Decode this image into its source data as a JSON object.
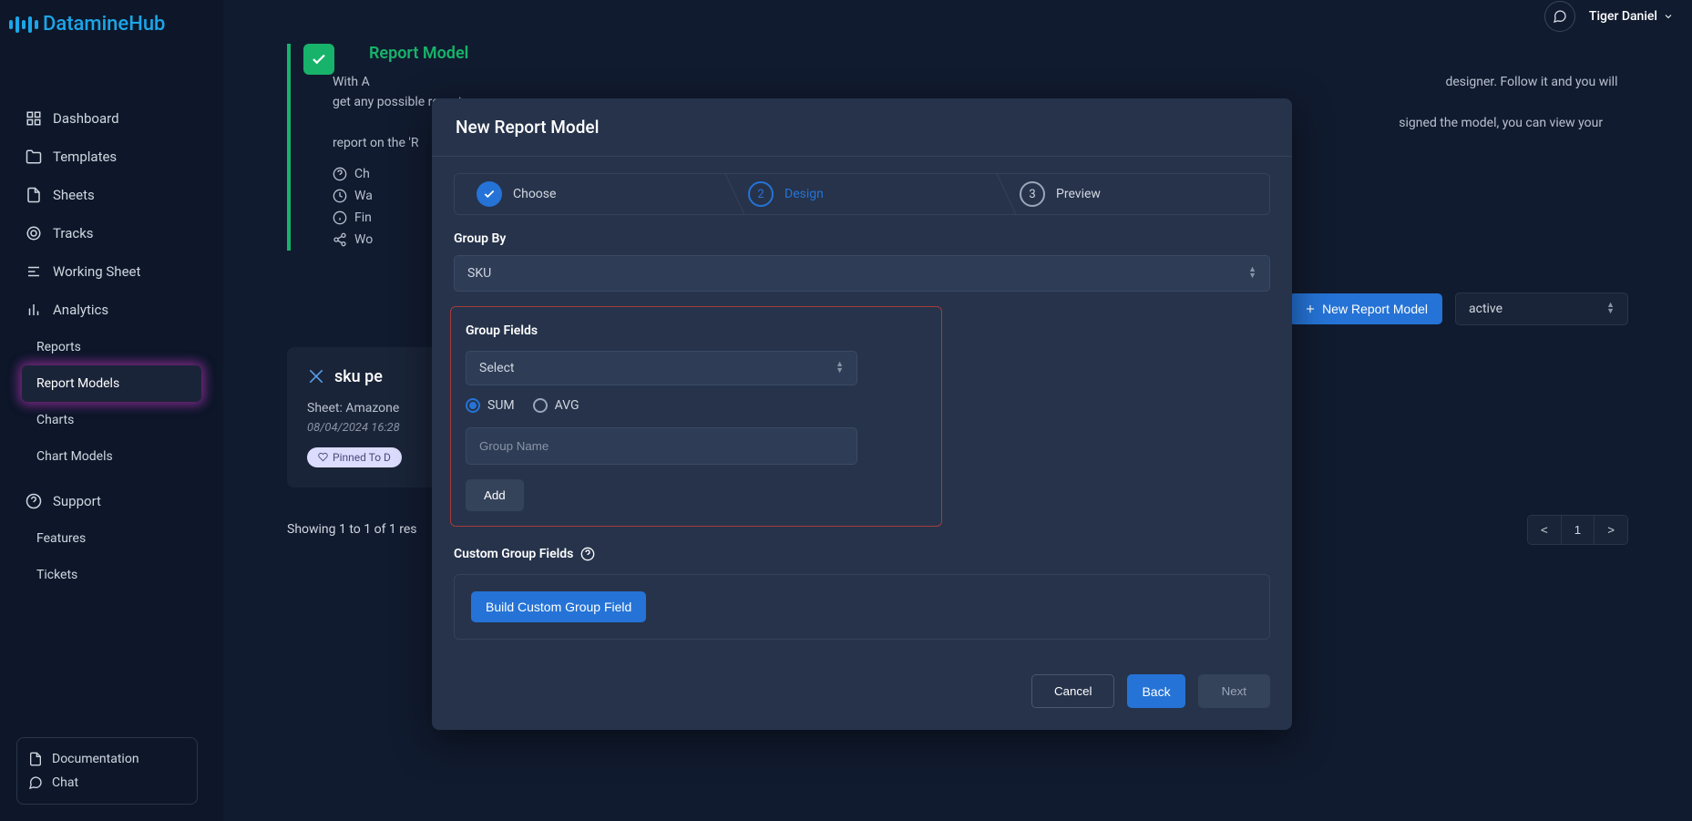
{
  "brand": "DatamineHub",
  "user": {
    "name": "Tiger Daniel"
  },
  "sidebar": {
    "items": [
      {
        "label": "Dashboard",
        "icon": "grid"
      },
      {
        "label": "Templates",
        "icon": "folder"
      },
      {
        "label": "Sheets",
        "icon": "file"
      },
      {
        "label": "Tracks",
        "icon": "target"
      },
      {
        "label": "Working Sheet",
        "icon": "list"
      },
      {
        "label": "Analytics",
        "icon": "bar"
      }
    ],
    "subitems": [
      {
        "label": "Reports"
      },
      {
        "label": "Report Models"
      },
      {
        "label": "Charts"
      },
      {
        "label": "Chart Models"
      }
    ],
    "support": {
      "label": "Support"
    },
    "features": {
      "label": "Features"
    },
    "tickets": {
      "label": "Tickets"
    },
    "bottom": {
      "documentation": "Documentation",
      "chat": "Chat"
    }
  },
  "banner": {
    "title": "Report Model",
    "text_prefix": "With A",
    "text_suffix": "designer. Follow it and you will get any possible report",
    "text_line2": "signed the model, you can view your report on the 'R",
    "list": [
      "Ch",
      "Wa",
      "Fin",
      "Wo"
    ]
  },
  "toolbar": {
    "new_button": "New Report Model",
    "filter_value": "active"
  },
  "card": {
    "title": "sku pe",
    "sheet_line": "Sheet: Amazone",
    "date": "08/04/2024 16:28",
    "badge": "Pinned To D"
  },
  "results": {
    "text": "Showing 1 to 1 of 1 res",
    "prev": "<",
    "page": "1",
    "next": ">"
  },
  "modal": {
    "title": "New Report Model",
    "steps": {
      "choose": "Choose",
      "design": "Design",
      "preview": "Preview",
      "step2_num": "2",
      "step3_num": "3"
    },
    "group_by_label": "Group By",
    "group_by_value": "SKU",
    "group_fields_label": "Group Fields",
    "select_placeholder": "Select",
    "agg": {
      "sum": "SUM",
      "avg": "AVG"
    },
    "group_name_placeholder": "Group Name",
    "add_button": "Add",
    "custom_label": "Custom Group Fields",
    "build_button": "Build Custom Group Field",
    "cancel": "Cancel",
    "back": "Back",
    "next": "Next"
  }
}
